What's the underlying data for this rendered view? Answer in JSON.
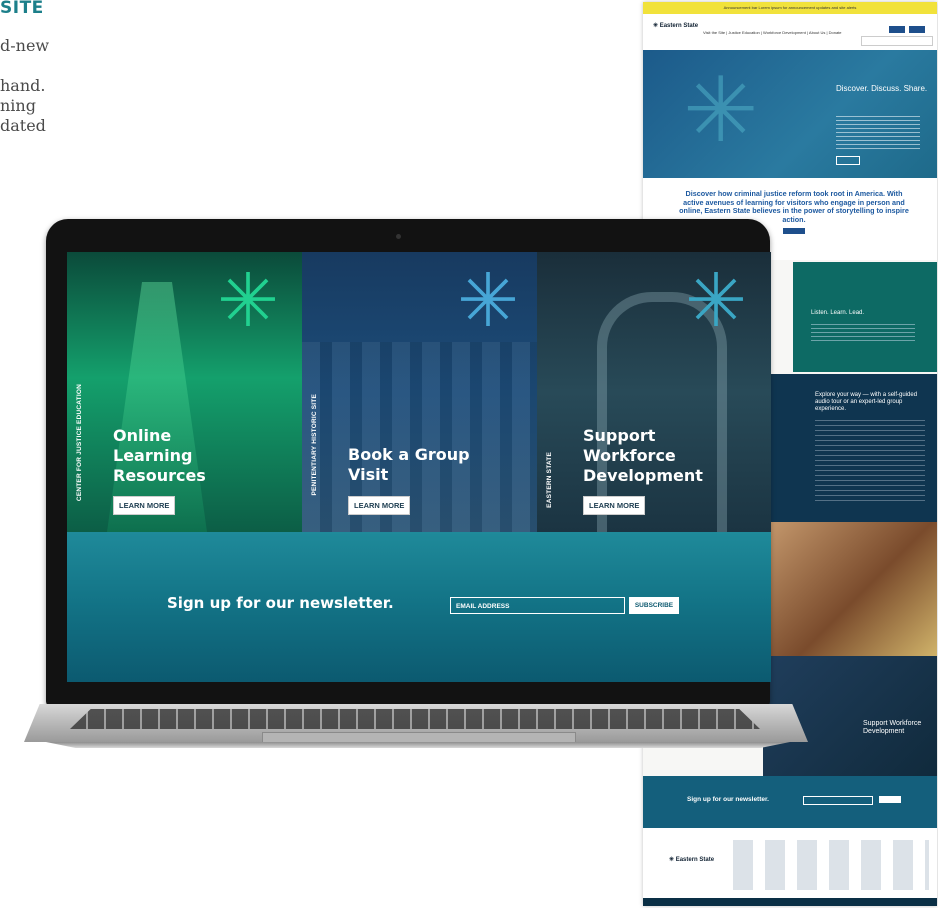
{
  "intro": {
    "heading": "SITE",
    "paragraph_lines": [
      "d-new",
      "",
      "hand.",
      "ning",
      "dated"
    ]
  },
  "webpage": {
    "alert_text": "Announcement bar  Lorem ipsum for announcement updates and site alerts",
    "logo": "Eastern State",
    "nav_links": "Visit the Site  |  Justice Education  |  Workforce Development  |  About Us  |  Donate",
    "hero_title": "Discover. Discuss. Share.",
    "intro_text": "Discover how criminal justice reform took root in America. With active avenues of learning for visitors who engage in person and online, Eastern State believes in the power of storytelling to inspire action.",
    "teal_text": "Listen. Learn. Lead.",
    "tour_text": "Explore your way — with a self-guided audio tour or an expert-led group experience.",
    "workforce_text": "Support Workforce Development",
    "newsletter_text": "Sign up for our newsletter.",
    "footer_logo": "Eastern State"
  },
  "laptop": {
    "panels": [
      {
        "vertical_label": "CENTER FOR JUSTICE EDUCATION",
        "title_lines": [
          "Online",
          "Learning",
          "Resources"
        ],
        "button": "LEARN MORE"
      },
      {
        "vertical_label": "PENITENTIARY HISTORIC SITE",
        "title_lines": [
          "Book a Group",
          "Visit"
        ],
        "button": "LEARN MORE"
      },
      {
        "vertical_label": "EASTERN STATE",
        "title_lines": [
          "Support",
          "Workforce",
          "Development"
        ],
        "button": "LEARN MORE"
      }
    ],
    "newsletter": {
      "text": "Sign up for our newsletter.",
      "email_placeholder": "EMAIL ADDRESS",
      "subscribe": "SUBSCRIBE"
    }
  },
  "colors": {
    "heading": "#1c7f8a",
    "green_panel": "#14a06c",
    "blue_panel": "#1d4d7a",
    "slate_panel": "#284a58",
    "newsletter_bg": "#127285"
  }
}
